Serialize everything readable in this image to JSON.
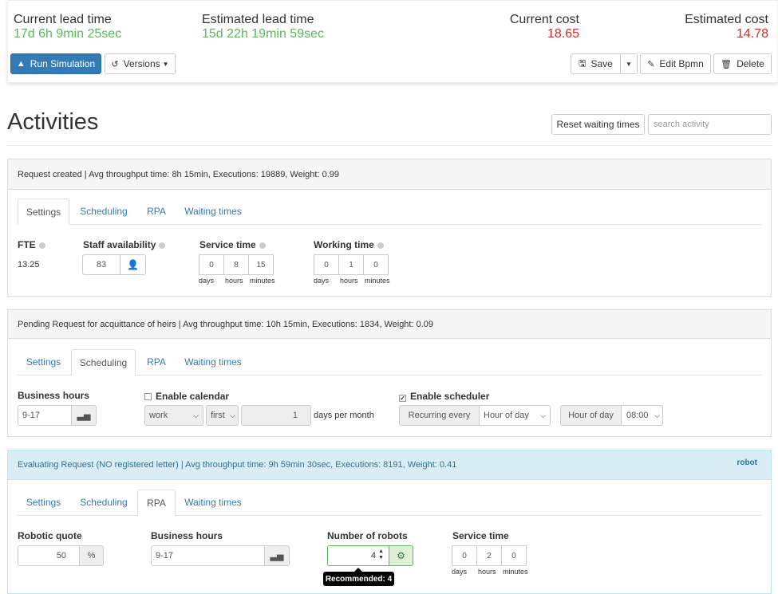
{
  "summary": {
    "current_lead_time_label": "Current lead time",
    "current_lead_time_value": "17d 6h 9min 25sec",
    "estimated_lead_time_label": "Estimated lead time",
    "estimated_lead_time_value": "15d 22h 19min 59sec",
    "current_cost_label": "Current cost",
    "current_cost_value": "18.65",
    "estimated_cost_label": "Estimated cost",
    "estimated_cost_value": "14.78"
  },
  "toolbar": {
    "run_label": "Run Simulation",
    "versions_label": "Versions",
    "save_label": "Save",
    "edit_bpmn_label": "Edit Bpmn",
    "delete_label": "Delete"
  },
  "activities": {
    "title": "Activities",
    "reset_label": "Reset waiting times",
    "search_placeholder": "search activity"
  },
  "tab_labels": [
    "Settings",
    "Scheduling",
    "RPA",
    "Waiting times"
  ],
  "panel1": {
    "header": "Request created | Avg throughput time: 8h 15min, Executions: 19889, Weight: 0.99",
    "fte_label": "FTE",
    "fte_value": "13.25",
    "staff_label": "Staff availability",
    "staff_value": "83",
    "service_label": "Service time",
    "service_days": "0",
    "service_hours": "8",
    "service_minutes": "15",
    "working_label": "Working time",
    "working_days": "0",
    "working_hours": "1",
    "working_minutes": "0",
    "unit_days": "days",
    "unit_hours": "hours",
    "unit_minutes": "minutes"
  },
  "panel2": {
    "header": "Pending Request for acquittance of heirs | Avg throughput time: 10h 15min, Executions: 1834, Weight: 0.09",
    "business_hours_label": "Business hours",
    "business_hours_value": "9-17",
    "enable_calendar_label": "Enable calendar",
    "calendar_type": "work",
    "calendar_order": "first",
    "calendar_count": "1",
    "days_per_month": "days per month",
    "enable_scheduler_label": "Enable scheduler",
    "recurring_label": "Recurring every",
    "recurring_value": "Hour of day",
    "hour_of_day_label": "Hour of day",
    "hour_value": "08:00"
  },
  "panel3": {
    "header": "Evaluating Request (NO registered letter) | Avg throughput time: 9h 59min 30sec, Executions: 8191, Weight: 0.41",
    "robot_label": "robot",
    "robotic_quote_label": "Robotic quote",
    "robotic_quote_value": "50",
    "percent": "%",
    "business_hours_label": "Business hours",
    "business_hours_value": "9-17",
    "robots_label": "Number of robots",
    "robots_value": "4",
    "recommended": "Recommended: 4",
    "service_label": "Service time",
    "service_days": "0",
    "service_hours": "2",
    "service_minutes": "0",
    "unit_days": "days",
    "unit_hours": "hours",
    "unit_minutes": "minutes"
  },
  "colors": {
    "green": "#5cb85c",
    "red": "#c9302c",
    "primary": "#337ab7",
    "info_bg": "#d9edf7",
    "info_text": "#31708f"
  }
}
